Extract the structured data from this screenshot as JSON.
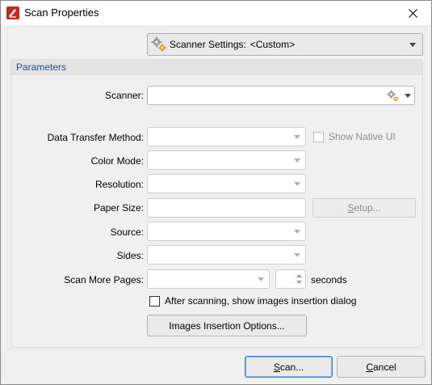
{
  "window": {
    "title": "Scan Properties",
    "app_icon": "pdf-xchange-icon",
    "close_icon": "close-icon"
  },
  "scanner_settings": {
    "label": "Scanner Settings:",
    "value": "<Custom>",
    "icon": "gear-icon"
  },
  "parameters": {
    "title": "Parameters",
    "scanner": {
      "label": "Scanner:",
      "value": "",
      "icon": "gear-icon"
    },
    "data_transfer_method": {
      "label": "Data Transfer Method:",
      "value": ""
    },
    "show_native_ui": {
      "label": "Show Native UI",
      "checked": false
    },
    "color_mode": {
      "label": "Color Mode:",
      "value": ""
    },
    "resolution": {
      "label": "Resolution:",
      "value": ""
    },
    "paper_size": {
      "label": "Paper Size:",
      "value": ""
    },
    "setup_button": {
      "prefix": "",
      "mnemonic": "S",
      "rest": "etup..."
    },
    "source": {
      "label": "Source:",
      "value": ""
    },
    "sides": {
      "label": "Sides:",
      "value": ""
    },
    "scan_more_pages": {
      "label": "Scan More Pages:",
      "value": "",
      "seconds_value": "",
      "seconds_label": "seconds"
    },
    "after_scanning": {
      "label": "After scanning, show images insertion dialog",
      "checked": false
    },
    "images_insertion_options": "Images Insertion Options..."
  },
  "footer": {
    "scan_button": {
      "mnemonic": "S",
      "rest": "can..."
    },
    "cancel_button": {
      "mnemonic": "C",
      "rest": "ancel"
    }
  },
  "colors": {
    "accent": "#1f4e9c",
    "primary_border": "#3c7fd4"
  }
}
